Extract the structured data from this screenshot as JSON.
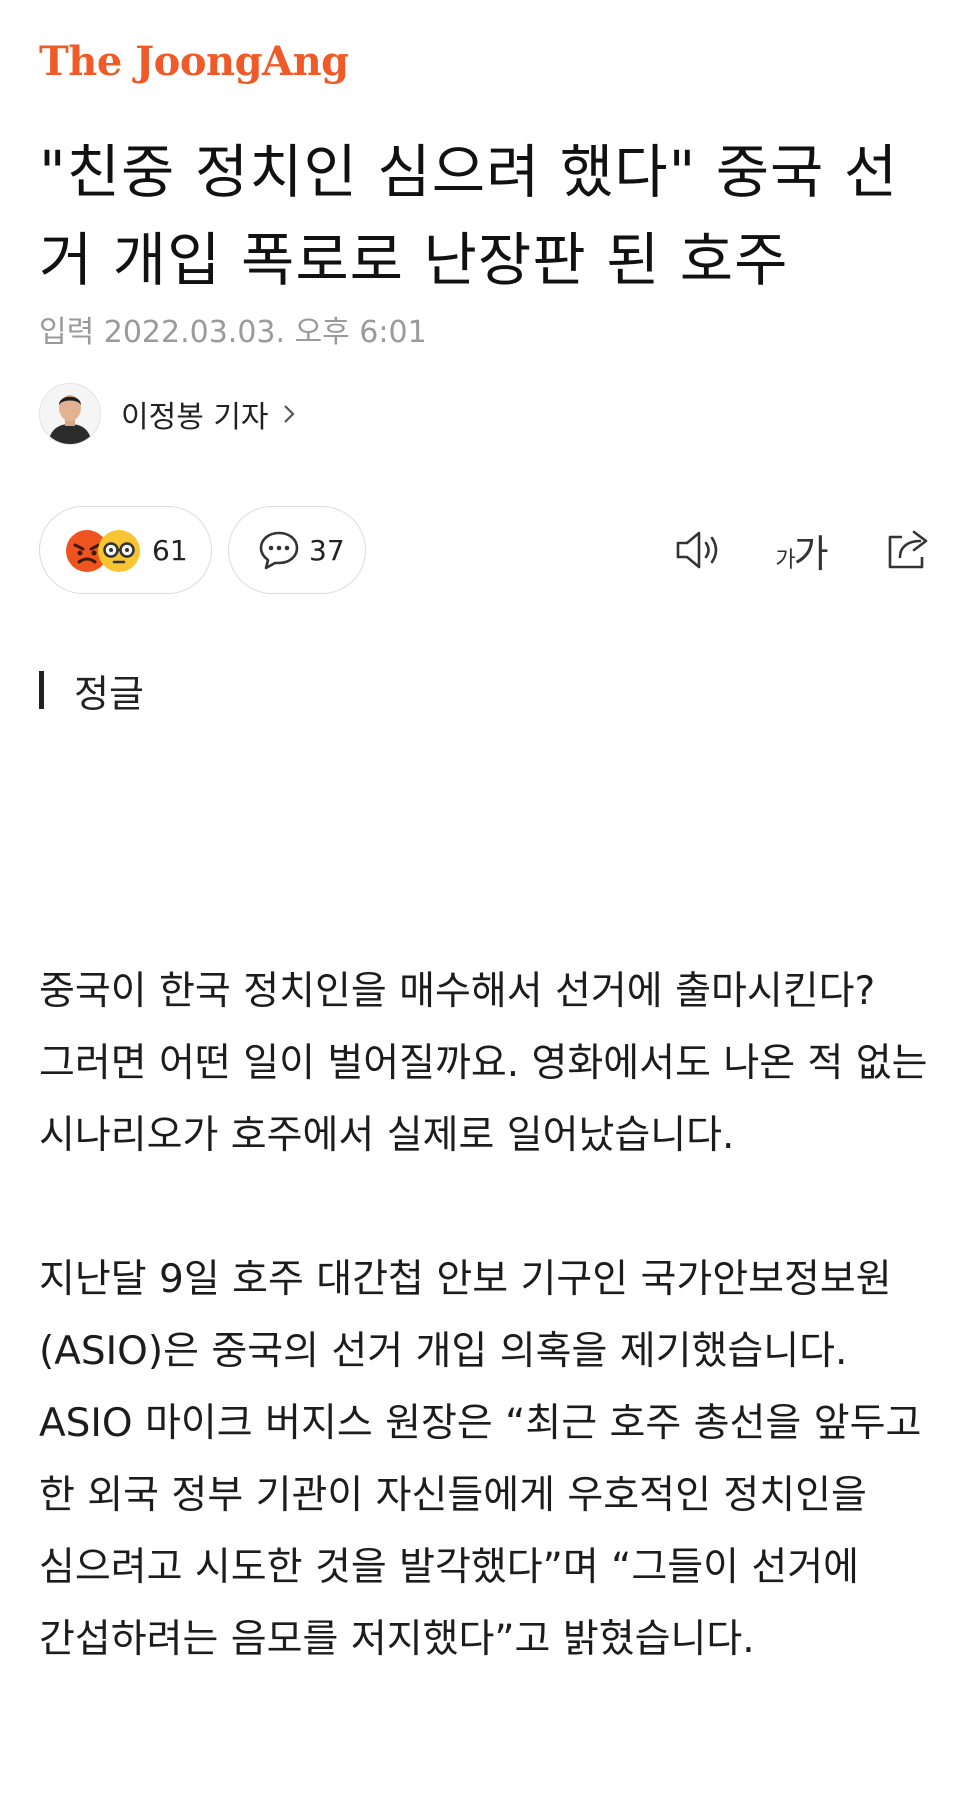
{
  "header": {
    "logo_text": "The JoongAng",
    "brand_color": "#f05a28"
  },
  "article": {
    "headline": "\"친중 정치인 심으려 했다\" 중국 선거 개입 폭로로 난장판 된 호주",
    "dateline": "입력 2022.03.03. 오후 6:01",
    "author": {
      "name": "이정봉 기자",
      "avatar_icon": "reporter-avatar"
    },
    "section_label": "정글",
    "paragraphs": [
      "중국이 한국 정치인을 매수해서 선거에 출마시킨다? 그러면 어떤 일이 벌어질까요. 영화에서도 나온 적 없는 시나리오가 호주에서 실제로 일어났습니다.",
      "지난달 9일 호주 대간첩 안보 기구인 국가안보정보원(ASIO)은 중국의 선거 개입 의혹을 제기했습니다. ASIO 마이크 버지스 원장은 “최근 호주 총선을 앞두고 한 외국 정부 기관이 자신들에게 우호적인 정치인을 심으려고 시도한 것을 발각했다”며 “그들이 선거에 간섭하려는 음모를 저지했다”고 밝혔습니다."
    ]
  },
  "action_bar": {
    "reactions": {
      "count": "61",
      "icons": [
        "angry-face-icon",
        "glasses-face-icon"
      ]
    },
    "comments": {
      "count": "37",
      "icon": "comment-icon"
    },
    "tools": {
      "audio_icon": "speaker-icon",
      "font_size_icon": "font-size-icon",
      "font_size_small": "가",
      "font_size_large": "가",
      "share_icon": "share-icon"
    }
  }
}
